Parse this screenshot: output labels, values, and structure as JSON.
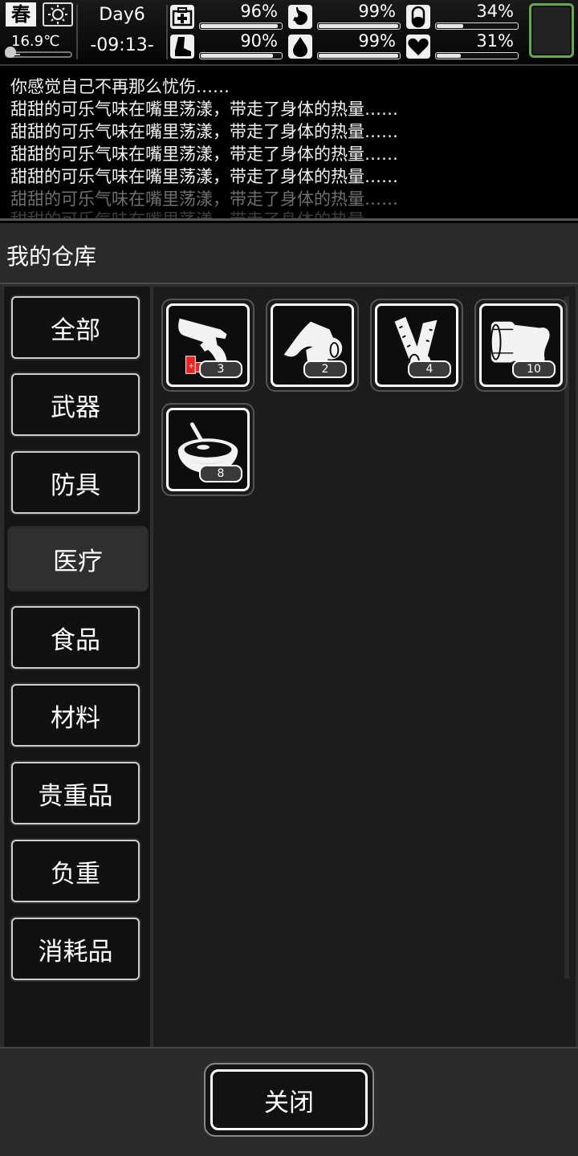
{
  "status": {
    "season": "春",
    "weather_icon": "sun-icon",
    "temperature": "16.9℃",
    "temperature_level": 0.2,
    "day": "Day6",
    "clock": "-09:13-",
    "stats": [
      {
        "key": "health",
        "icon": "medkit-icon",
        "label": "96%",
        "value": 96
      },
      {
        "key": "stomach",
        "icon": "stomach-icon",
        "label": "99%",
        "value": 99
      },
      {
        "key": "pill",
        "icon": "pill-icon",
        "label": "34%",
        "value": 34
      },
      {
        "key": "stamina",
        "icon": "boot-icon",
        "label": "90%",
        "value": 90
      },
      {
        "key": "water",
        "icon": "water-drop-icon",
        "label": "99%",
        "value": 99
      },
      {
        "key": "mood",
        "icon": "heart-icon",
        "label": "31%",
        "value": 31
      }
    ]
  },
  "log": [
    "你感觉自己不再那么忧伤……",
    "甜甜的可乐气味在嘴里荡漾，带走了身体的热量……",
    "甜甜的可乐气味在嘴里荡漾，带走了身体的热量……",
    "甜甜的可乐气味在嘴里荡漾，带走了身体的热量……",
    "甜甜的可乐气味在嘴里荡漾，带走了身体的热量……",
    "甜甜的可乐气味在嘴里荡漾，带走了身体的热量……",
    "甜甜的可乐气味在嘴里荡漾，带走了身体的热量……"
  ],
  "panel": {
    "title": "我的仓库",
    "categories": [
      {
        "label": "全部",
        "active": false
      },
      {
        "label": "武器",
        "active": false
      },
      {
        "label": "防具",
        "active": false
      },
      {
        "label": "医疗",
        "active": true
      },
      {
        "label": "食品",
        "active": false
      },
      {
        "label": "材料",
        "active": false
      },
      {
        "label": "贵重品",
        "active": false
      },
      {
        "label": "负重",
        "active": false
      },
      {
        "label": "消耗品",
        "active": false
      }
    ],
    "items": [
      {
        "icon": "flare-gun-icon",
        "count": "3"
      },
      {
        "icon": "bandage-roll-icon",
        "count": "2"
      },
      {
        "icon": "splint-icon",
        "count": "4"
      },
      {
        "icon": "cast-icon",
        "count": "10"
      },
      {
        "icon": "bowl-icon",
        "count": "8"
      }
    ],
    "close_label": "关闭"
  }
}
